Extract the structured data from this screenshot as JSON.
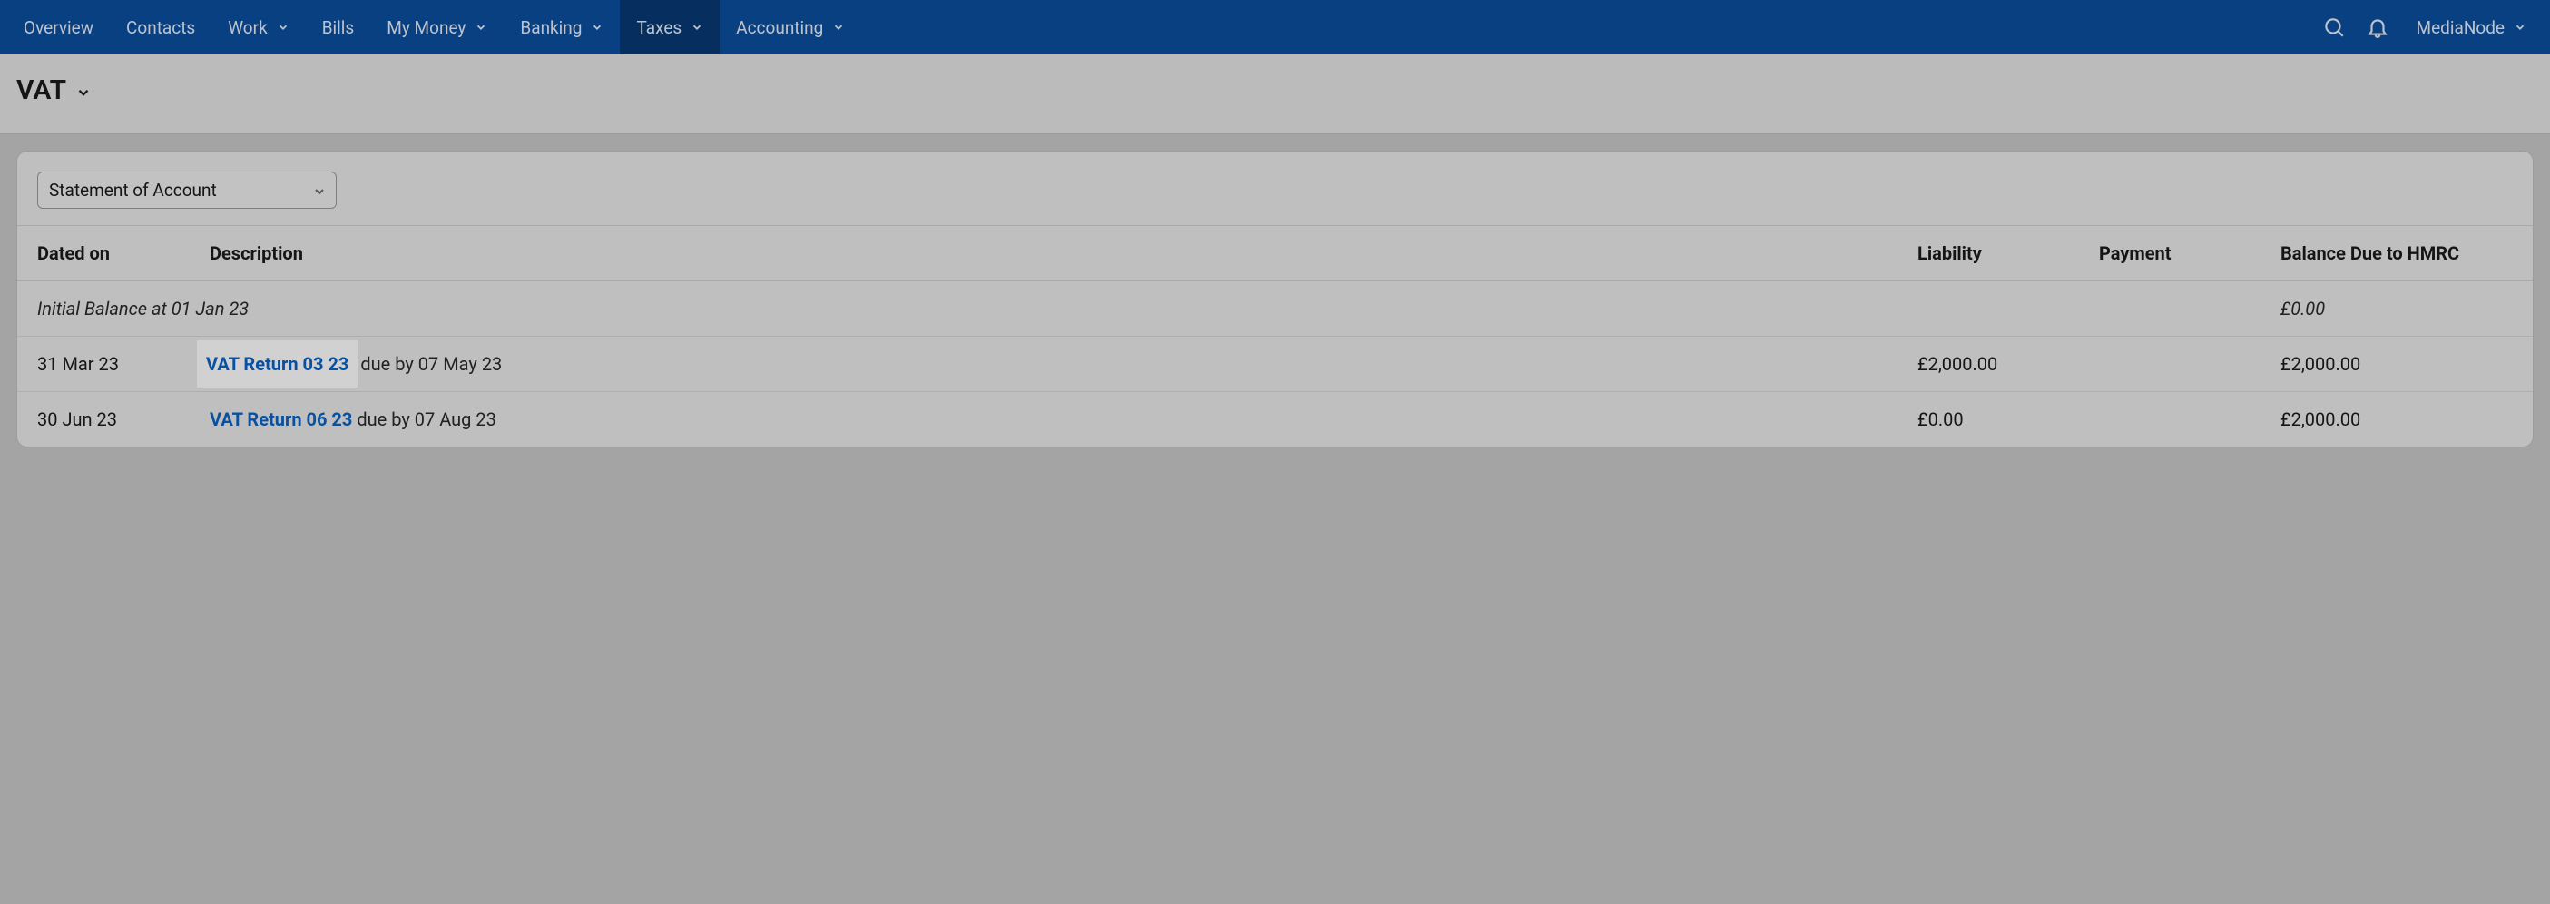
{
  "nav": {
    "items": [
      {
        "label": "Overview",
        "hasMenu": false
      },
      {
        "label": "Contacts",
        "hasMenu": false
      },
      {
        "label": "Work",
        "hasMenu": true
      },
      {
        "label": "Bills",
        "hasMenu": false
      },
      {
        "label": "My Money",
        "hasMenu": true
      },
      {
        "label": "Banking",
        "hasMenu": true
      },
      {
        "label": "Taxes",
        "hasMenu": true,
        "active": true
      },
      {
        "label": "Accounting",
        "hasMenu": true
      }
    ],
    "user_label": "MediaNode"
  },
  "page": {
    "title": "VAT"
  },
  "panel": {
    "select_label": "Statement of Account"
  },
  "table": {
    "headers": {
      "date": "Dated on",
      "desc": "Description",
      "liab": "Liability",
      "pay": "Payment",
      "bal": "Balance Due to HMRC"
    },
    "initial_row": {
      "text": "Initial Balance at 01 Jan 23",
      "balance": "£0.00"
    },
    "rows": [
      {
        "date": "31 Mar 23",
        "link_text": "VAT Return 03 23",
        "due_text": " due by 07 May 23",
        "liability": "£2,000.00",
        "payment": "",
        "balance": "£2,000.00",
        "highlight": true
      },
      {
        "date": "30 Jun 23",
        "link_text": "VAT Return 06 23",
        "due_text": " due by 07 Aug 23",
        "liability": "£0.00",
        "payment": "",
        "balance": "£2,000.00",
        "highlight": false
      }
    ]
  }
}
